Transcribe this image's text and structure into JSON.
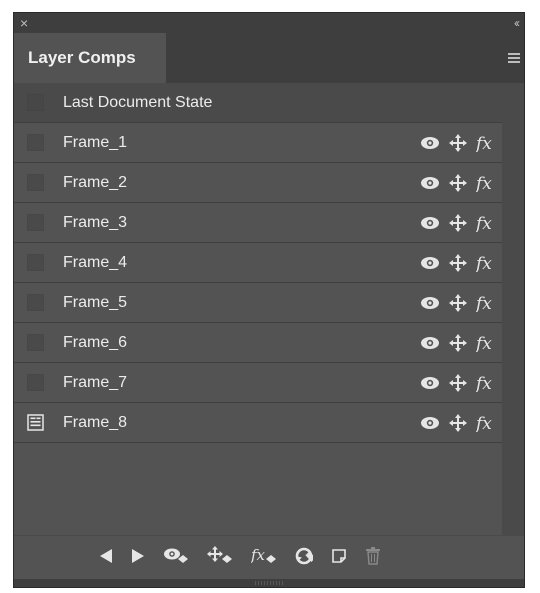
{
  "panel": {
    "close_icon": "close-icon",
    "collapse_glyph": "‹‹",
    "tab_label": "Layer Comps",
    "menu_icon": "panel-menu-icon"
  },
  "comps": [
    {
      "name": "Last Document State",
      "active": false,
      "show_icons": false
    },
    {
      "name": "Frame_1",
      "active": false,
      "show_icons": true
    },
    {
      "name": "Frame_2",
      "active": false,
      "show_icons": true
    },
    {
      "name": "Frame_3",
      "active": false,
      "show_icons": true
    },
    {
      "name": "Frame_4",
      "active": false,
      "show_icons": true
    },
    {
      "name": "Frame_5",
      "active": false,
      "show_icons": true
    },
    {
      "name": "Frame_6",
      "active": false,
      "show_icons": true
    },
    {
      "name": "Frame_7",
      "active": false,
      "show_icons": true
    },
    {
      "name": "Frame_8",
      "active": true,
      "show_icons": true
    }
  ],
  "row_icons": [
    "visibility-eye-icon",
    "position-move-icon",
    "layer-style-fx-icon"
  ],
  "toolbar": [
    "previous-comp-icon",
    "next-comp-icon",
    "apply-visibility-icon",
    "apply-position-icon",
    "apply-appearance-icon",
    "update-comp-icon",
    "new-comp-icon",
    "delete-comp-icon"
  ],
  "colors": {
    "panel_bg": "#535353",
    "chrome_bg": "#3e3e3e",
    "text": "#ececec",
    "icon": "#e6e6e6",
    "disabled_icon": "#8a8a8a"
  }
}
